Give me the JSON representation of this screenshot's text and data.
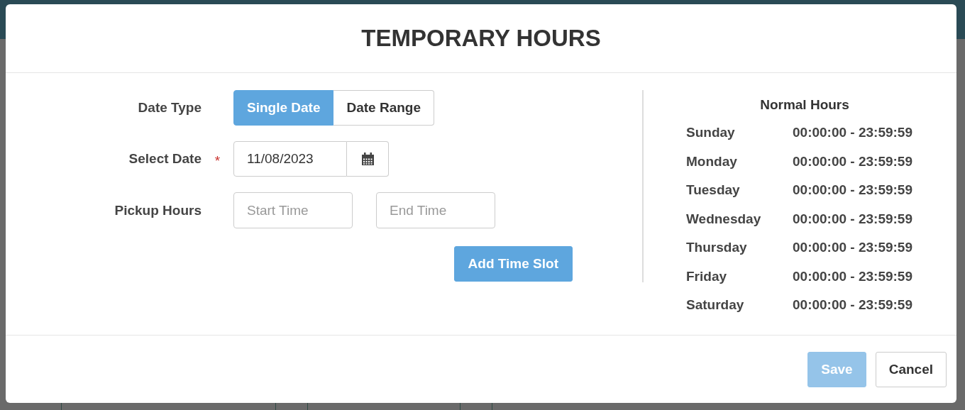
{
  "dialog": {
    "title": "TEMPORARY HOURS"
  },
  "date_type": {
    "label": "Date Type",
    "options": [
      {
        "label": "Single Date",
        "selected": true
      },
      {
        "label": "Date Range",
        "selected": false
      }
    ]
  },
  "select_date": {
    "label": "Select Date",
    "required_mark": "*",
    "value": "11/08/2023"
  },
  "pickup_hours": {
    "label": "Pickup Hours",
    "start_placeholder": "Start Time",
    "end_placeholder": "End Time"
  },
  "add_time_slot": {
    "label": "Add Time Slot"
  },
  "normal_hours": {
    "title": "Normal Hours",
    "days": [
      {
        "day": "Sunday",
        "hours": "00:00:00 - 23:59:59"
      },
      {
        "day": "Monday",
        "hours": "00:00:00 - 23:59:59"
      },
      {
        "day": "Tuesday",
        "hours": "00:00:00 - 23:59:59"
      },
      {
        "day": "Wednesday",
        "hours": "00:00:00 - 23:59:59"
      },
      {
        "day": "Thursday",
        "hours": "00:00:00 - 23:59:59"
      },
      {
        "day": "Friday",
        "hours": "00:00:00 - 23:59:59"
      },
      {
        "day": "Saturday",
        "hours": "00:00:00 - 23:59:59"
      }
    ]
  },
  "footer": {
    "buttons": [
      {
        "label": "Save",
        "kind": "primary",
        "disabled": true
      },
      {
        "label": "Cancel",
        "kind": "default",
        "disabled": false
      }
    ]
  }
}
